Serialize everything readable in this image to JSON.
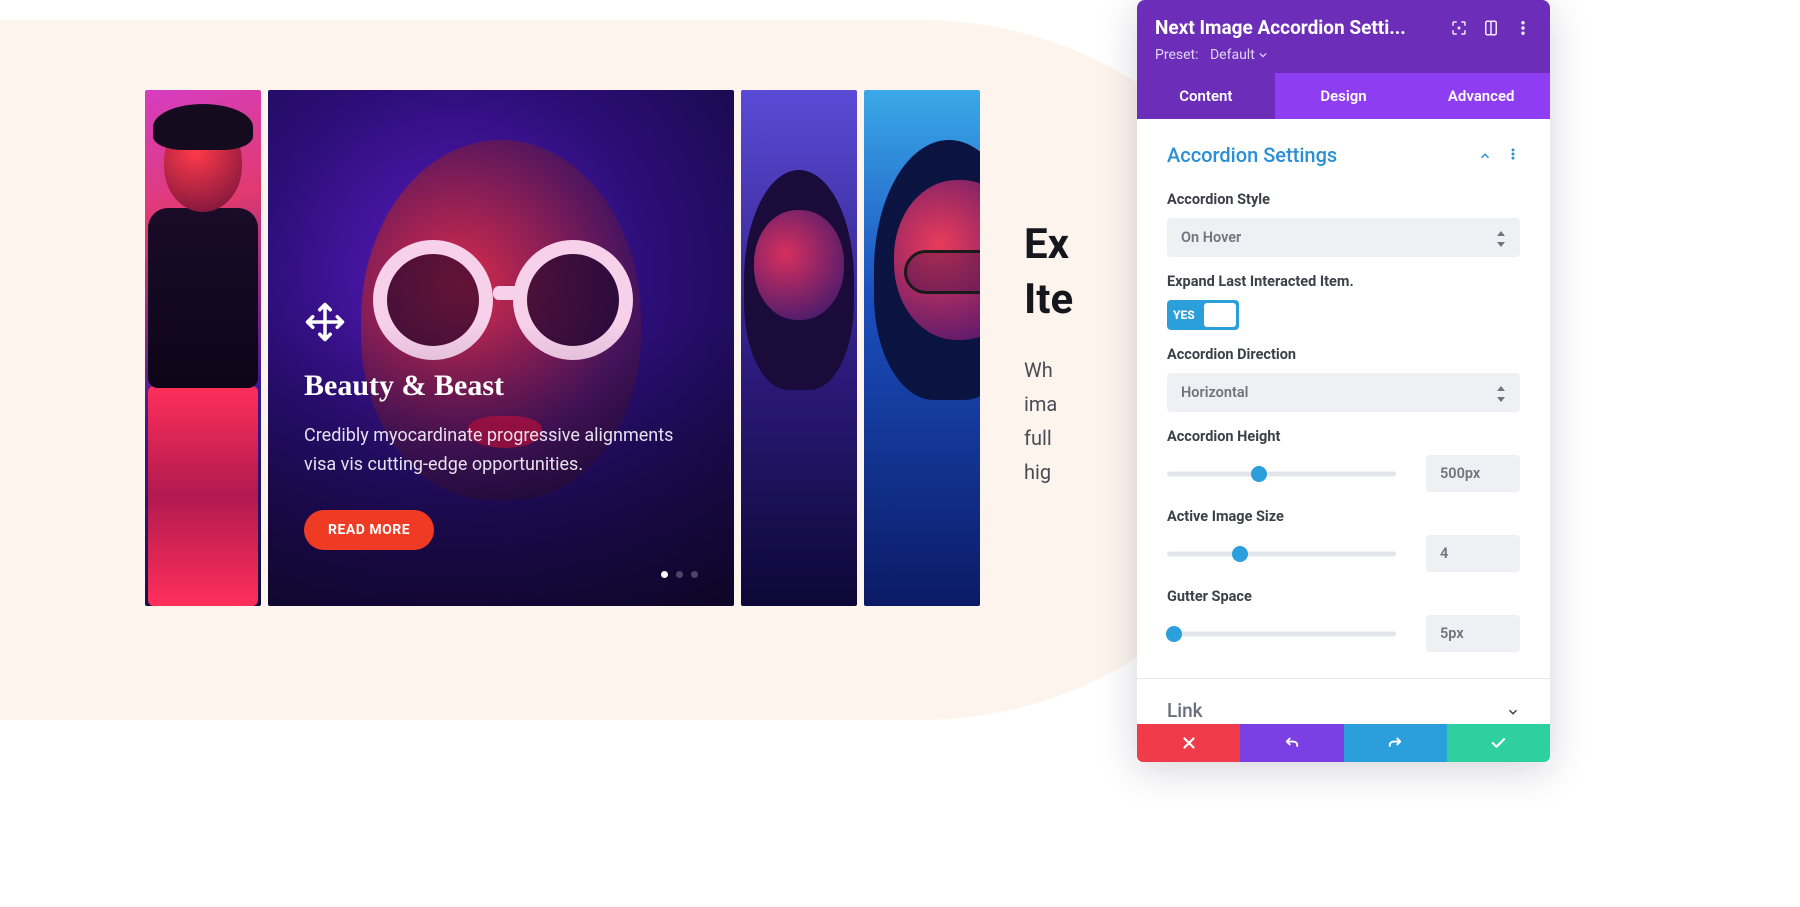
{
  "page": {
    "heading_line1": "Ex",
    "heading_line2": "Ite",
    "body_line1": "Wh",
    "body_line2": "ima",
    "body_line3": "full",
    "body_line4": "hig"
  },
  "accordion": {
    "active": {
      "title": "Beauty & Beast",
      "description": "Credibly myocardinate progressive alignments visa vis cutting-edge opportunities.",
      "button": "READ MORE"
    }
  },
  "panel": {
    "title": "Next Image Accordion Setti...",
    "preset_label": "Preset:",
    "preset_value": "Default",
    "tabs": {
      "content": "Content",
      "design": "Design",
      "advanced": "Advanced"
    },
    "sections": {
      "accordion_settings": "Accordion Settings",
      "link": "Link"
    },
    "fields": {
      "accordion_style": {
        "label": "Accordion Style",
        "value": "On Hover"
      },
      "expand_last": {
        "label": "Expand Last Interacted Item.",
        "value": "YES"
      },
      "direction": {
        "label": "Accordion Direction",
        "value": "Horizontal"
      },
      "height": {
        "label": "Accordion Height",
        "value": "500px",
        "pct": 40
      },
      "active_size": {
        "label": "Active Image Size",
        "value": "4",
        "pct": 32
      },
      "gutter": {
        "label": "Gutter Space",
        "value": "5px",
        "pct": 3
      }
    }
  }
}
